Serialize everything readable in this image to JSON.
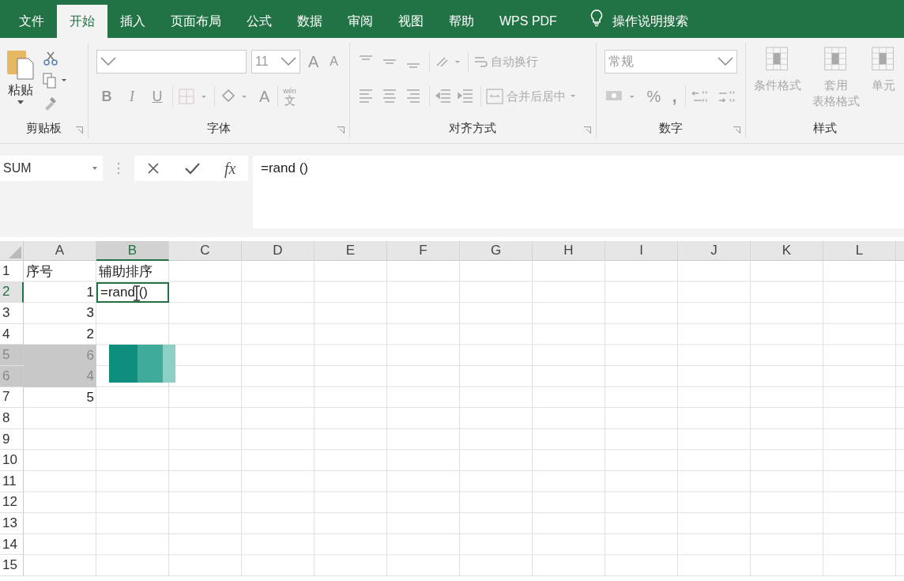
{
  "tabs": [
    {
      "label": "文件",
      "selected": false
    },
    {
      "label": "开始",
      "selected": true
    },
    {
      "label": "插入",
      "selected": false
    },
    {
      "label": "页面布局",
      "selected": false
    },
    {
      "label": "公式",
      "selected": false
    },
    {
      "label": "数据",
      "selected": false
    },
    {
      "label": "审阅",
      "selected": false
    },
    {
      "label": "视图",
      "selected": false
    },
    {
      "label": "帮助",
      "selected": false
    },
    {
      "label": "WPS PDF",
      "selected": false
    }
  ],
  "tell_me": {
    "placeholder": "操作说明搜索"
  },
  "ribbon": {
    "clipboard": {
      "paste": "粘贴",
      "label": "剪贴板"
    },
    "font": {
      "size": "11",
      "grow": "A",
      "shrink": "A",
      "styles": [
        "B",
        "I",
        "U"
      ],
      "font_color": "A",
      "phonetic_top": "wén",
      "phonetic_bottom": "文",
      "label": "字体"
    },
    "alignment": {
      "wrap": "自动换行",
      "merge": "合并后居中",
      "label": "对齐方式"
    },
    "number": {
      "format": "常规",
      "percent": "%",
      "comma": ",",
      "label": "数字"
    },
    "styles": {
      "items": [
        {
          "top": "条件格式"
        },
        {
          "top": "套用",
          "bottom": "表格格式"
        },
        {
          "top": "单元"
        }
      ],
      "label": "样式"
    }
  },
  "formula_bar": {
    "name_box": "SUM",
    "fx": "fx",
    "value": "=rand ()"
  },
  "sheet": {
    "columns": [
      {
        "label": "A",
        "selected": false
      },
      {
        "label": "B",
        "selected": true
      },
      {
        "label": "C",
        "selected": false
      },
      {
        "label": "D",
        "selected": false
      },
      {
        "label": "E",
        "selected": false
      },
      {
        "label": "F",
        "selected": false
      },
      {
        "label": "G",
        "selected": false
      },
      {
        "label": "H",
        "selected": false
      },
      {
        "label": "I",
        "selected": false
      },
      {
        "label": "J",
        "selected": false
      },
      {
        "label": "K",
        "selected": false
      },
      {
        "label": "L",
        "selected": false
      }
    ],
    "rows": [
      {
        "number": "1",
        "selected": false,
        "dimmed": false,
        "cells": [
          "序号",
          "辅助排序"
        ]
      },
      {
        "number": "2",
        "selected": true,
        "dimmed": false,
        "cells": [
          "1",
          "=rand ()"
        ]
      },
      {
        "number": "3",
        "selected": false,
        "dimmed": false,
        "cells": [
          "3"
        ]
      },
      {
        "number": "4",
        "selected": false,
        "dimmed": false,
        "cells": [
          "2"
        ]
      },
      {
        "number": "5",
        "selected": false,
        "dimmed": true,
        "cells": [
          "6"
        ]
      },
      {
        "number": "6",
        "selected": false,
        "dimmed": true,
        "cells": [
          "4"
        ]
      },
      {
        "number": "7",
        "selected": false,
        "dimmed": false,
        "cells": [
          "5"
        ]
      },
      {
        "number": "8",
        "selected": false,
        "dimmed": false,
        "cells": []
      },
      {
        "number": "9",
        "selected": false,
        "dimmed": false,
        "cells": []
      },
      {
        "number": "10",
        "selected": false,
        "dimmed": false,
        "cells": []
      },
      {
        "number": "11",
        "selected": false,
        "dimmed": false,
        "cells": []
      },
      {
        "number": "12",
        "selected": false,
        "dimmed": false,
        "cells": []
      },
      {
        "number": "13",
        "selected": false,
        "dimmed": false,
        "cells": []
      },
      {
        "number": "14",
        "selected": false,
        "dimmed": false,
        "cells": []
      },
      {
        "number": "15",
        "selected": false,
        "dimmed": false,
        "cells": []
      }
    ]
  }
}
